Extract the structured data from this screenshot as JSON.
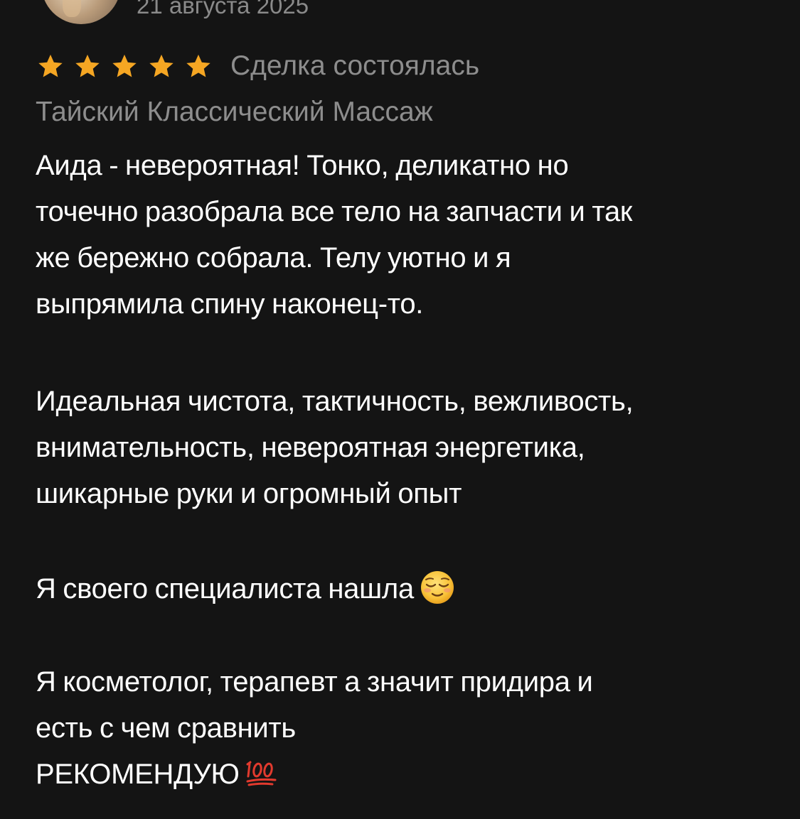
{
  "review": {
    "date": "21 августа 2025",
    "rating": 5,
    "status": "Сделка состоялась",
    "service": "Тайский Классический Массаж",
    "paragraphs": {
      "p1": [
        "Аида - невероятная! Тонко, деликатно но",
        "точечно разобрала все тело на запчасти и так",
        "же бережно собрала. Телу уютно и я",
        "выпрямила спину наконец-то."
      ],
      "p2": [
        "Идеальная чистота, тактичность, вежливость,",
        "внимательность, невероятная энергетика,",
        "шикарные руки и огромный опыт"
      ],
      "p3": "Я своего специалиста нашла",
      "p4": [
        "Я косметолог, терапевт а значит придира и",
        "есть с чем сравнить",
        "РЕКОМЕНДУЮ"
      ]
    },
    "icons": {
      "star": "star-icon",
      "relieved_face": "relieved-face-emoji-icon",
      "hundred_points": "hundred-points-emoji-icon"
    },
    "colors": {
      "background": "#141414",
      "text": "#ffffff",
      "muted_text": "#8d8d8d",
      "star": "#f5a623"
    }
  }
}
